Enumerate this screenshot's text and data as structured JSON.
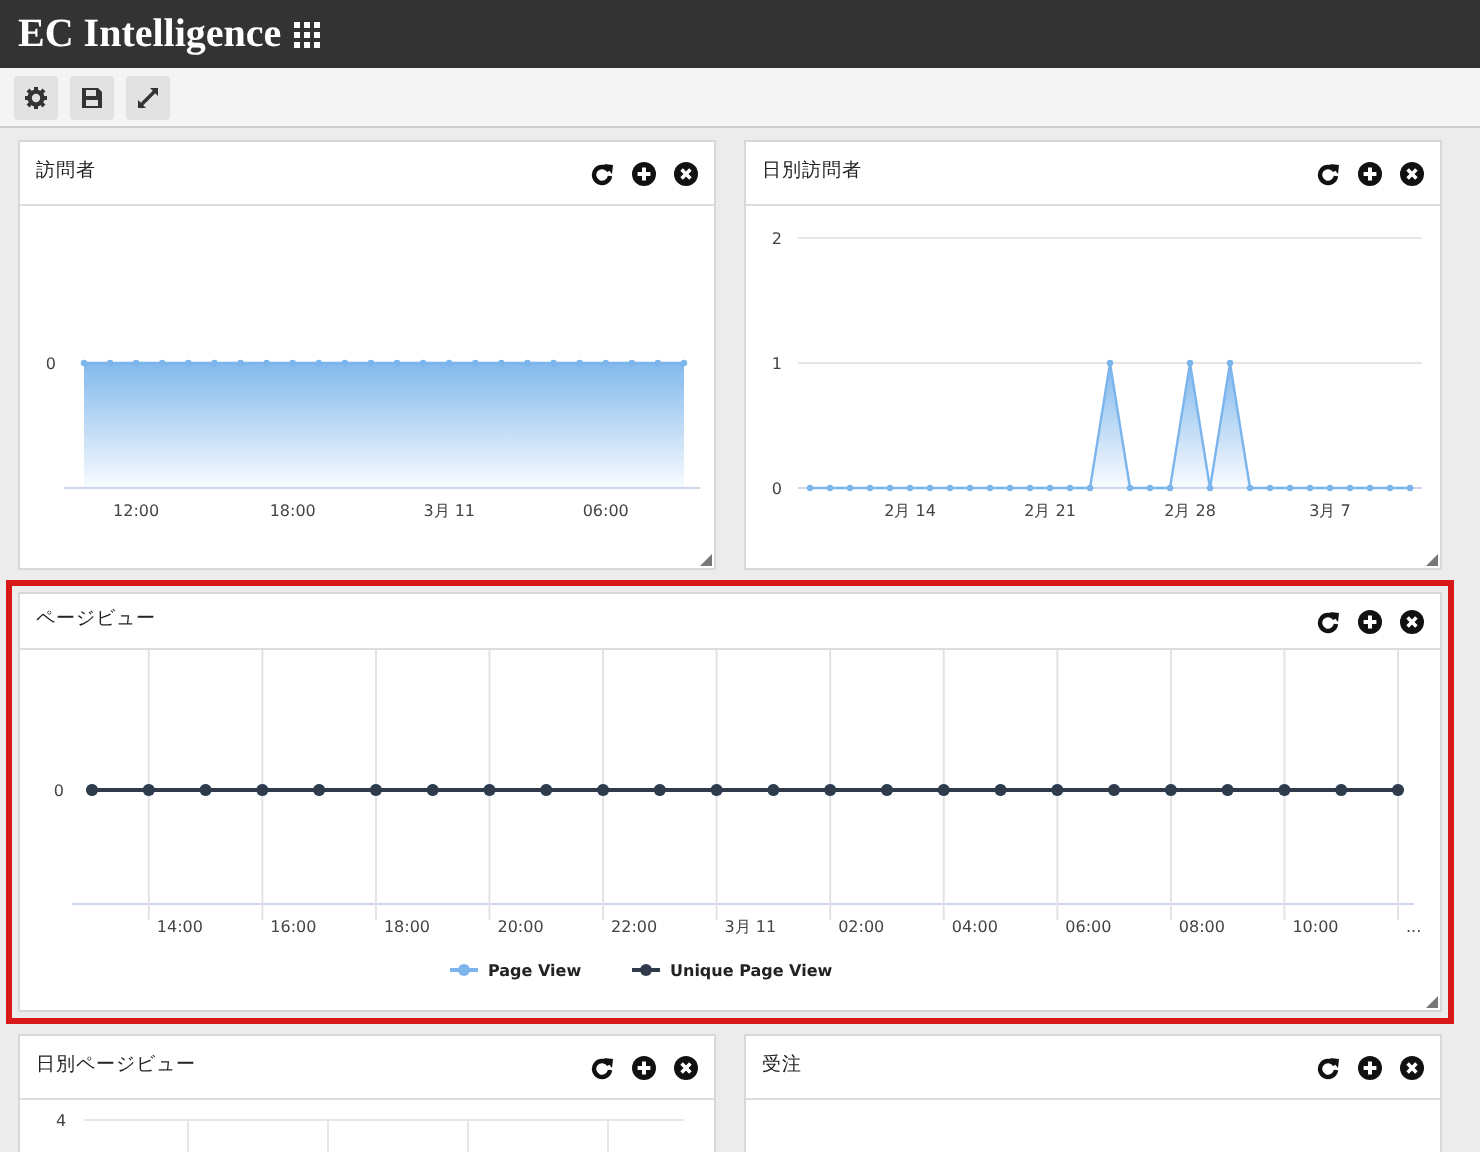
{
  "app": {
    "title": "EC Intelligence"
  },
  "toolbar": [
    {
      "kind": "settings"
    },
    {
      "kind": "save"
    },
    {
      "kind": "expand"
    }
  ],
  "rows": [
    [
      {
        "title": "訪問者",
        "highlighted": false,
        "plot": {
          "kind": "area",
          "y_labels": [
            "0"
          ],
          "x_labels": [
            "12:00",
            "18:00",
            "3月 11",
            "06:00"
          ]
        }
      },
      {
        "title": "日別訪問者",
        "highlighted": false,
        "chart_data": {
          "type": "area",
          "categories": [
            null,
            null,
            null,
            null,
            null,
            "2月 14",
            null,
            null,
            null,
            null,
            null,
            null,
            "2月 21",
            null,
            null,
            null,
            null,
            null,
            null,
            "2月 28",
            null,
            null,
            null,
            null,
            null,
            null,
            "3月 7",
            null,
            null,
            null,
            null
          ],
          "ylim": [
            0,
            2
          ],
          "yticks": [
            0,
            1,
            2
          ],
          "series": [
            {
              "color": "#7cb5ec",
              "values": [
                0,
                0,
                0,
                0,
                0,
                0,
                0,
                0,
                0,
                0,
                0,
                0,
                0,
                0,
                0,
                1,
                0,
                0,
                0,
                1,
                0,
                1,
                0,
                0,
                0,
                0,
                0,
                0,
                0,
                0,
                0
              ]
            }
          ]
        }
      }
    ],
    [
      {
        "title": "ページビュー",
        "highlighted": true,
        "plot": {
          "kind": "line",
          "y_labels": [
            "0"
          ],
          "x_labels": [
            "14:00",
            "16:00",
            "18:00",
            "20:00",
            "22:00",
            "3月 11",
            "02:00",
            "04:00",
            "06:00",
            "08:00",
            "10:00",
            "..."
          ],
          "legend": [
            {
              "name": "Page View",
              "color": "#7cb5ec"
            },
            {
              "name": "Unique Page View",
              "color": "#2f3b4a"
            }
          ]
        }
      }
    ],
    [
      {
        "title": "日別ページビュー",
        "highlighted": false,
        "plot": {
          "kind": "grid",
          "y_labels": [
            "4"
          ]
        }
      },
      {
        "title": "受注",
        "highlighted": false
      }
    ]
  ]
}
